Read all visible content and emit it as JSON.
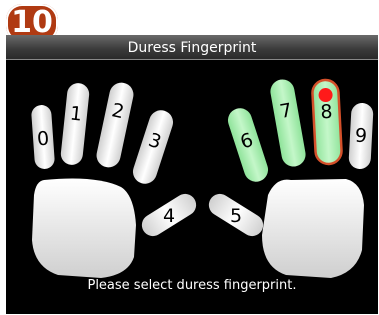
{
  "step_number": "10",
  "title": "Duress Fingerprint",
  "prompt": "Please select duress fingerprint.",
  "fingers": [
    {
      "label": "0",
      "state": "unregistered"
    },
    {
      "label": "1",
      "state": "unregistered"
    },
    {
      "label": "2",
      "state": "unregistered"
    },
    {
      "label": "3",
      "state": "unregistered"
    },
    {
      "label": "4",
      "state": "unregistered"
    },
    {
      "label": "5",
      "state": "unregistered"
    },
    {
      "label": "6",
      "state": "registered"
    },
    {
      "label": "7",
      "state": "registered"
    },
    {
      "label": "8",
      "state": "selected"
    },
    {
      "label": "9",
      "state": "unregistered"
    }
  ],
  "colors": {
    "registered": "#a8f0b0",
    "unregistered": "#e8e8e8",
    "selected_border": "#d4502a",
    "selected_dot": "#ff1a1a",
    "badge": "#b03a12"
  }
}
